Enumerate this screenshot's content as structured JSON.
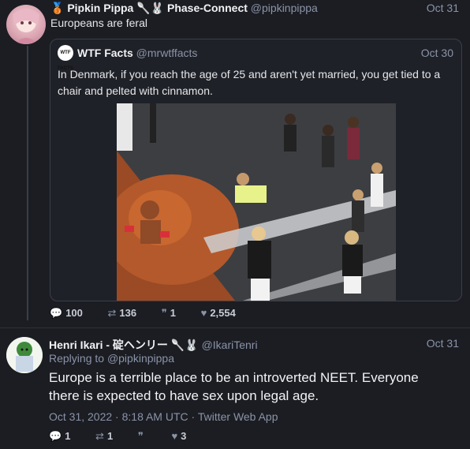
{
  "tweet1": {
    "badge_emoji": "🥉",
    "name": "Pipkin Pippa",
    "name_suffix": "🥄🐰 Phase-Connect",
    "handle": "@pipkinpippa",
    "date": "Oct 31",
    "text": "Europeans are feral",
    "quote": {
      "logo_text": "WTF FACTS",
      "name": "WTF Facts",
      "handle": "@mrwtffacts",
      "date": "Oct 30",
      "text": "In Denmark, if you reach the age of 25 and aren't yet married, you get tied to a chair and pelted with cinnamon."
    },
    "stats": {
      "replies": "100",
      "retweets": "136",
      "quotes": "1",
      "likes": "2,554"
    }
  },
  "tweet2": {
    "name": "Henri Ikari - 碇ヘンリー",
    "name_suffix": "🥄🐰",
    "handle": "@IkariTenri",
    "date": "Oct 31",
    "reply_prefix": "Replying to",
    "reply_handle": "@pipkinpippa",
    "text": "Europe is a terrible place to be an introverted NEET. Everyone there is expected to have sex upon legal age.",
    "meta": "Oct 31, 2022 · 8:18 AM UTC · Twitter Web App",
    "stats": {
      "replies": "1",
      "retweets": "1",
      "quotes": "",
      "likes": "3"
    }
  },
  "icons": {
    "reply": "reply-icon",
    "retweet": "retweet-icon",
    "quote": "quote-icon",
    "like": "heart-icon"
  },
  "colors": {
    "background": "#1b1d23",
    "muted": "#8b93a7",
    "text": "#e6e7ea"
  }
}
